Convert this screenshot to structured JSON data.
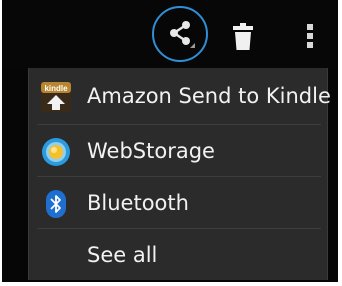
{
  "action_bar": {
    "share_icon": "share-icon",
    "delete_icon": "trash-icon",
    "overflow_icon": "overflow-menu-icon"
  },
  "share_menu": {
    "items": [
      {
        "label": "Amazon Send to Kindle",
        "icon": "kindle-app-icon"
      },
      {
        "label": "WebStorage",
        "icon": "webstorage-app-icon"
      },
      {
        "label": "Bluetooth",
        "icon": "bluetooth-icon"
      },
      {
        "label": "See all"
      }
    ]
  },
  "colors": {
    "screen_background": "#060606",
    "menu_background": "#2b2b2b",
    "highlight_ring": "#2f8fd6",
    "text": "#f2f2f2"
  }
}
